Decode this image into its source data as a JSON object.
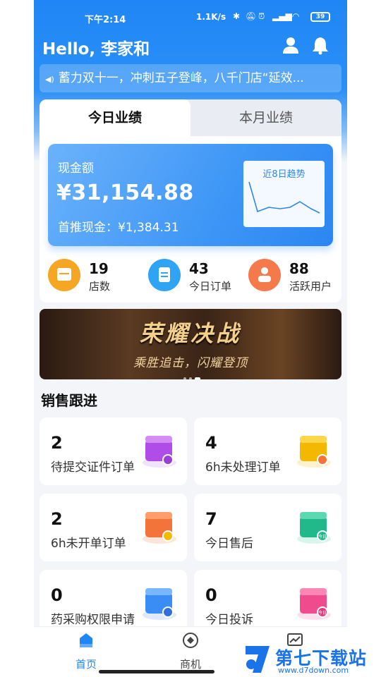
{
  "status_bar": {
    "time": "下午2:14",
    "network_speed": "1.1K/s",
    "battery": "39"
  },
  "header": {
    "greeting": "Hello, 李家和",
    "icons": [
      "user-icon",
      "bell-icon"
    ]
  },
  "notice": {
    "text": "蓄力双十一，冲刺五子登峰，八千门店“延效..."
  },
  "tabs": [
    {
      "label": "今日业绩",
      "active": true
    },
    {
      "label": "本月业绩",
      "active": false
    }
  ],
  "cash_card": {
    "label": "现金额",
    "amount": "¥31,154.88",
    "first_push": "首推现金：¥1,384.31",
    "trend_title": "近8日趋势"
  },
  "stats": [
    {
      "value": "19",
      "label": "店数",
      "icon": "store-icon",
      "color": "#f5a623"
    },
    {
      "value": "43",
      "label": "今日订单",
      "icon": "clipboard-icon",
      "color": "#2fa4f5"
    },
    {
      "value": "88",
      "label": "活跃用户",
      "icon": "user-icon",
      "color": "#f47a4c"
    }
  ],
  "banner": {
    "title": "荣耀决战",
    "subtitle": "乘胜追击，闪耀登顶"
  },
  "section": {
    "title": "销售跟进"
  },
  "tiles": [
    {
      "value": "2",
      "label": "待提交证件订单",
      "icon": "upload-box-icon",
      "color": "#b04de8"
    },
    {
      "value": "4",
      "label": "6h未处理订单",
      "icon": "clock-box-icon",
      "color": "#f5b800"
    },
    {
      "value": "2",
      "label": "6h未开单订单",
      "icon": "cancel-box-icon",
      "color": "#f4733a"
    },
    {
      "value": "7",
      "label": "今日售后",
      "icon": "return-box-icon",
      "color": "#22b98a"
    },
    {
      "value": "0",
      "label": "药采购权限申请",
      "icon": "star-box-icon",
      "color": "#3a8df5"
    },
    {
      "value": "0",
      "label": "今日投诉",
      "icon": "complaint-box-icon",
      "color": "#f04b8c"
    }
  ],
  "tile_badges": {
    "return": "今日",
    "complaint": "今日"
  },
  "bottom_nav": [
    {
      "label": "首页",
      "icon": "home-icon",
      "active": true
    },
    {
      "label": "商机",
      "icon": "target-icon",
      "active": false
    },
    {
      "label": "",
      "icon": "chart-icon",
      "active": false
    }
  ],
  "watermark": {
    "title": "第七下载站",
    "url": "www.d7down.com"
  },
  "colors": {
    "primary": "#1f86f5",
    "background": "#f4f5f8"
  }
}
